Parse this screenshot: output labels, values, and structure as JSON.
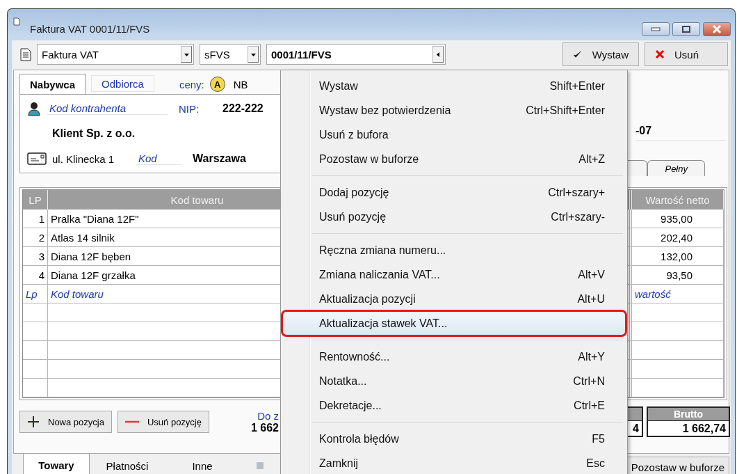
{
  "window": {
    "title": "Faktura VAT 0001/11/FVS"
  },
  "toolbar": {
    "document_type": "Faktura VAT",
    "series": "sFVS",
    "number": "0001/11/FVS",
    "buttons": [
      {
        "label": "Wystaw",
        "kind": "confirm"
      },
      {
        "label": "Usuń",
        "kind": "delete"
      }
    ]
  },
  "party_tabs": [
    {
      "label": "Nabywca",
      "selected": true
    },
    {
      "label": "Odbiorca",
      "selected": false
    }
  ],
  "prices": {
    "label": "ceny:",
    "badge": "A",
    "value": "NB"
  },
  "customer": {
    "code_placeholder": "Kod kontrahenta",
    "nip_label": "NIP:",
    "nip": "222-222",
    "name": "Klient Sp. z o.o.",
    "street": "ul. Klinecka 1",
    "postal_placeholder": "Kod",
    "city": "Warszawa"
  },
  "date_fragment": "-07",
  "view_tabs": [
    {
      "label": "Pełny",
      "selected": false
    }
  ],
  "table": {
    "columns": [
      {
        "label": "LP"
      },
      {
        "label": "Kod towaru"
      },
      {
        "label": "Wartość netto"
      }
    ],
    "rows": [
      {
        "lp": "1",
        "code": "Pralka \"Diana 12F\"",
        "net": "935,00"
      },
      {
        "lp": "2",
        "code": "Atlas 14 silnik",
        "net": "202,40"
      },
      {
        "lp": "3",
        "code": "Diana 12F bęben",
        "net": "132,00"
      },
      {
        "lp": "4",
        "code": "Diana 12F grzałka",
        "net": "93,50"
      }
    ],
    "new_row": {
      "lp": "Lp",
      "code": "Kod towaru",
      "net": "wartość"
    }
  },
  "row_buttons": [
    {
      "label": "Nowa pozycja",
      "kind": "add"
    },
    {
      "label": "Usuń pozycję",
      "kind": "remove"
    }
  ],
  "total": {
    "label": "Do z",
    "value": "1 662"
  },
  "summary": {
    "partial_value": "4",
    "brutto_label": "Brutto",
    "brutto": "1 662,74"
  },
  "bottom_tabs": [
    {
      "label": "Towary",
      "selected": true
    },
    {
      "label": "Płatności",
      "selected": false
    },
    {
      "label": "Inne",
      "selected": false
    }
  ],
  "buffer_button": "Pozostaw w buforze",
  "context_menu": {
    "groups": [
      {
        "items": [
          {
            "label": "Wystaw",
            "shortcut": "Shift+Enter",
            "highlighted": false
          },
          {
            "label": "Wystaw bez potwierdzenia",
            "shortcut": "Ctrl+Shift+Enter",
            "highlighted": false
          },
          {
            "label": "Usuń z bufora",
            "highlighted": false
          },
          {
            "label": "Pozostaw w buforze",
            "shortcut": "Alt+Z",
            "highlighted": false
          }
        ]
      },
      {
        "items": [
          {
            "label": "Dodaj pozycję",
            "shortcut": "Ctrl+szary+",
            "highlighted": false
          },
          {
            "label": "Usuń pozycję",
            "shortcut": "Ctrl+szary-",
            "highlighted": false
          }
        ]
      },
      {
        "items": [
          {
            "label": "Ręczna zmiana numeru...",
            "highlighted": false
          },
          {
            "label": "Zmiana naliczania VAT...",
            "shortcut": "Alt+V",
            "highlighted": false
          },
          {
            "label": "Aktualizacja pozycji",
            "shortcut": "Alt+U",
            "highlighted": false
          },
          {
            "label": "Aktualizacja stawek VAT...",
            "highlighted": true
          }
        ]
      },
      {
        "items": [
          {
            "label": "Rentowność...",
            "shortcut": "Alt+Y",
            "highlighted": false
          },
          {
            "label": "Notatka...",
            "shortcut": "Ctrl+N",
            "highlighted": false
          },
          {
            "label": "Dekretacje...",
            "shortcut": "Ctrl+E",
            "highlighted": false
          }
        ]
      },
      {
        "items": [
          {
            "label": "Kontrola błędów",
            "shortcut": "F5",
            "highlighted": false
          },
          {
            "label": "Zamknij",
            "shortcut": "Esc",
            "highlighted": false
          }
        ]
      }
    ]
  }
}
